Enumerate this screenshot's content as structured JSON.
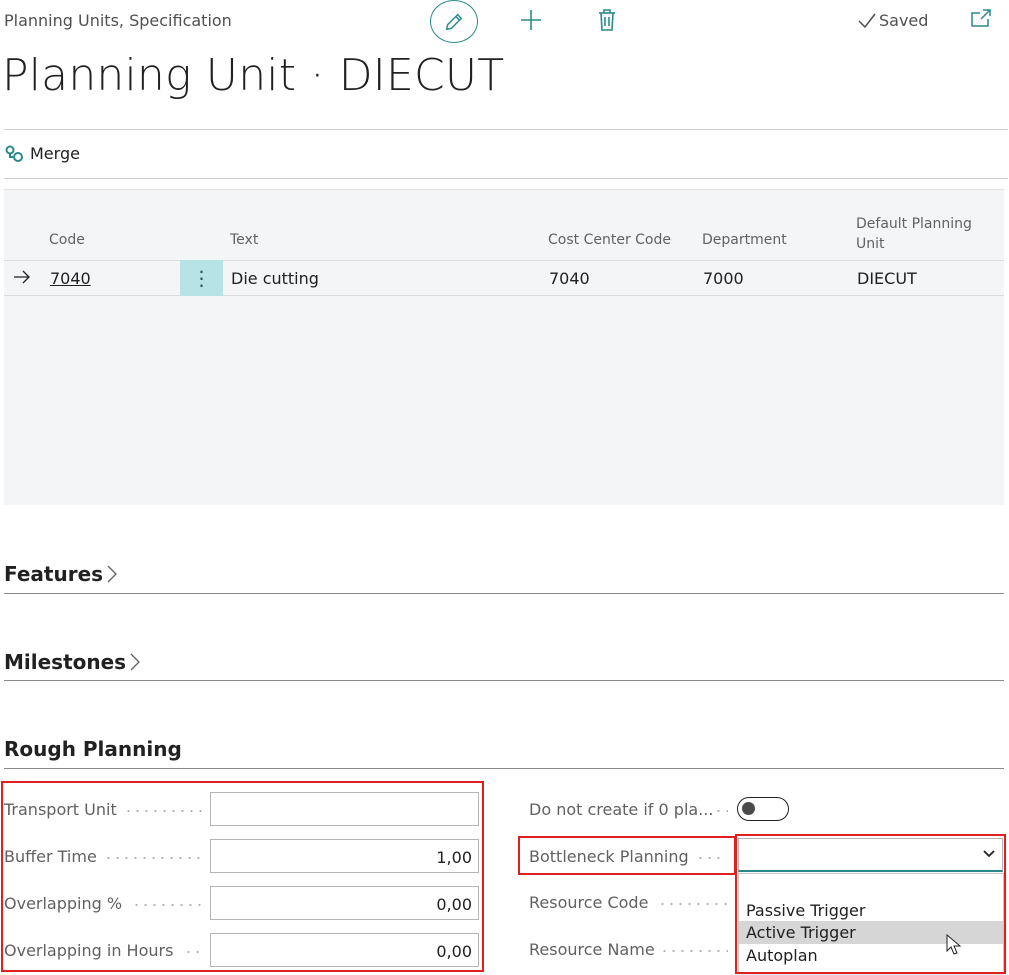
{
  "header": {
    "breadcrumb": "Planning Units, Specification",
    "saved_label": "Saved",
    "title": "Planning Unit · DIECUT"
  },
  "actions": {
    "merge_label": "Merge"
  },
  "grid": {
    "columns": {
      "code": "Code",
      "text": "Text",
      "cost_center": "Cost Center Code",
      "department": "Department",
      "default_planning_unit_line1": "Default Planning",
      "default_planning_unit_line2": "Unit"
    },
    "rows": [
      {
        "code": "7040",
        "text": "Die cutting",
        "cost_center": "7040",
        "department": "7000",
        "default_planning_unit": "DIECUT"
      }
    ]
  },
  "sections": {
    "features": "Features",
    "milestones": "Milestones",
    "rough_planning": "Rough Planning"
  },
  "rough_planning": {
    "transport_unit": {
      "label": "Transport Unit",
      "value": ""
    },
    "buffer_time": {
      "label": "Buffer Time",
      "value": "1,00"
    },
    "overlapping_pct": {
      "label": "Overlapping %",
      "value": "0,00"
    },
    "overlapping_hours": {
      "label": "Overlapping in Hours",
      "value": "0,00"
    },
    "do_not_create": {
      "label": "Do not create if 0 pla...",
      "value": false
    },
    "bottleneck_planning": {
      "label": "Bottleneck Planning",
      "value": "",
      "options": [
        "Passive Trigger",
        "Active Trigger",
        "Autoplan"
      ],
      "highlighted": "Active Trigger"
    },
    "resource_code": {
      "label": "Resource Code"
    },
    "resource_name": {
      "label": "Resource Name"
    }
  },
  "colors": {
    "accent": "#2a8a8a",
    "highlight_box": "#e02020",
    "row_menu_bg": "#b8e3e6"
  }
}
